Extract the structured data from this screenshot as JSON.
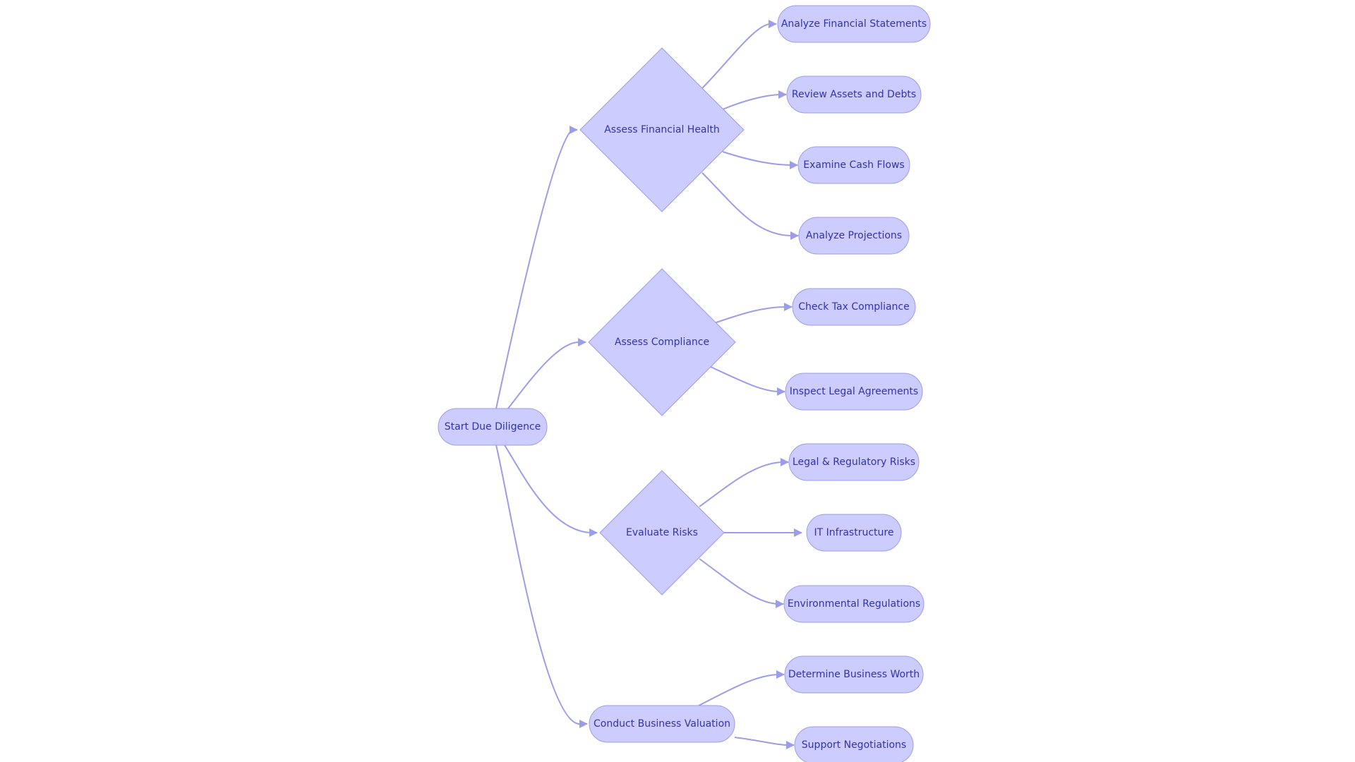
{
  "diagram": {
    "type": "flowchart",
    "direction": "left-to-right",
    "colors": {
      "node_fill": "#CCCCFF",
      "node_stroke": "#9C9CEB",
      "edge": "#9C9CEB",
      "text": "#3333AA",
      "background": "#FFFFFF"
    },
    "nodes": [
      {
        "id": "start",
        "label": "Start Due Diligence",
        "shape": "stadium"
      },
      {
        "id": "afh",
        "label": "Assess Financial Health",
        "shape": "diamond"
      },
      {
        "id": "ac",
        "label": "Assess Compliance",
        "shape": "diamond"
      },
      {
        "id": "er",
        "label": "Evaluate Risks",
        "shape": "diamond"
      },
      {
        "id": "cbv",
        "label": "Conduct Business Valuation",
        "shape": "stadium"
      },
      {
        "id": "afs",
        "label": "Analyze Financial Statements",
        "shape": "stadium"
      },
      {
        "id": "rad",
        "label": "Review Assets and Debts",
        "shape": "stadium"
      },
      {
        "id": "ecf",
        "label": "Examine Cash Flows",
        "shape": "stadium"
      },
      {
        "id": "ap",
        "label": "Analyze Projections",
        "shape": "stadium"
      },
      {
        "id": "ctc",
        "label": "Check Tax Compliance",
        "shape": "stadium"
      },
      {
        "id": "ila",
        "label": "Inspect Legal Agreements",
        "shape": "stadium"
      },
      {
        "id": "lrr",
        "label": "Legal & Regulatory Risks",
        "shape": "stadium"
      },
      {
        "id": "iti",
        "label": "IT Infrastructure",
        "shape": "stadium"
      },
      {
        "id": "envr",
        "label": "Environmental Regulations",
        "shape": "stadium"
      },
      {
        "id": "dbw",
        "label": "Determine Business Worth",
        "shape": "stadium"
      },
      {
        "id": "sn",
        "label": "Support Negotiations",
        "shape": "stadium"
      }
    ],
    "edges": [
      {
        "from": "start",
        "to": "afh"
      },
      {
        "from": "start",
        "to": "ac"
      },
      {
        "from": "start",
        "to": "er"
      },
      {
        "from": "start",
        "to": "cbv"
      },
      {
        "from": "afh",
        "to": "afs"
      },
      {
        "from": "afh",
        "to": "rad"
      },
      {
        "from": "afh",
        "to": "ecf"
      },
      {
        "from": "afh",
        "to": "ap"
      },
      {
        "from": "ac",
        "to": "ctc"
      },
      {
        "from": "ac",
        "to": "ila"
      },
      {
        "from": "er",
        "to": "lrr"
      },
      {
        "from": "er",
        "to": "iti"
      },
      {
        "from": "er",
        "to": "envr"
      },
      {
        "from": "cbv",
        "to": "dbw"
      },
      {
        "from": "cbv",
        "to": "sn"
      }
    ]
  }
}
